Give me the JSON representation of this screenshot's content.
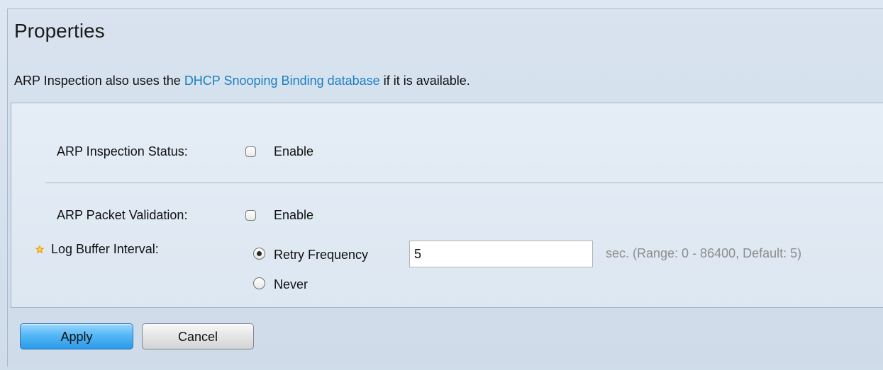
{
  "page": {
    "title": "Properties",
    "description_prefix": "ARP Inspection also uses the ",
    "description_link": "DHCP Snooping Binding database",
    "description_suffix": " if it is available."
  },
  "form": {
    "arp_inspection_status": {
      "label": "ARP Inspection Status:",
      "checkbox_label": "Enable",
      "checked": false
    },
    "arp_packet_validation": {
      "label": "ARP Packet Validation:",
      "checkbox_label": "Enable",
      "checked": false
    },
    "log_buffer_interval": {
      "label": "Log Buffer Interval:",
      "retry_frequency_label": "Retry Frequency",
      "retry_frequency_value": "5",
      "retry_frequency_hint": "sec. (Range: 0 - 86400, Default: 5)",
      "never_label": "Never",
      "selected": "Retry Frequency"
    }
  },
  "buttons": {
    "apply": "Apply",
    "cancel": "Cancel"
  },
  "icons": {
    "required_marker": "star-icon"
  },
  "colors": {
    "link": "#1b7fc2",
    "apply_button": "#2a9ae8",
    "required_marker": "#f0a51a"
  }
}
